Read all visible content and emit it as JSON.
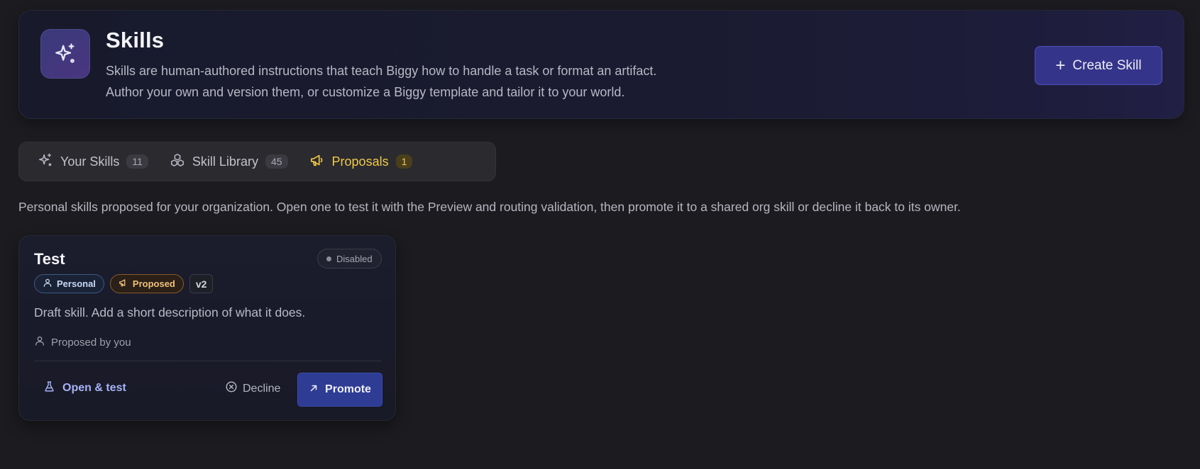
{
  "header": {
    "title": "Skills",
    "description_line1": "Skills are human-authored instructions that teach Biggy how to handle a task or format an artifact.",
    "description_line2": "Author your own and version them, or customize a Biggy template and tailor it to your world.",
    "icon": "sparkles-icon",
    "create_button_label": "Create Skill"
  },
  "tabs": [
    {
      "label": "Your Skills",
      "count": "11",
      "icon": "sparkles-icon",
      "active": false
    },
    {
      "label": "Skill Library",
      "count": "45",
      "icon": "boxes-icon",
      "active": false
    },
    {
      "label": "Proposals",
      "count": "1",
      "icon": "megaphone-icon",
      "active": true
    }
  ],
  "intro": "Personal skills proposed for your organization. Open one to test it with the Preview and routing validation, then promote it to a shared org skill or decline it back to its owner.",
  "card": {
    "title": "Test",
    "status": "Disabled",
    "chips": {
      "personal": "Personal",
      "proposed": "Proposed",
      "version": "v2"
    },
    "description": "Draft skill. Add a short description of what it does.",
    "proposed_by": "Proposed by you",
    "actions": {
      "open": "Open & test",
      "decline": "Decline",
      "promote": "Promote"
    }
  },
  "colors": {
    "accent": "#34358a",
    "active_tab": "#f0c84a",
    "promote": "#2f3c94",
    "link": "#a6b2f4"
  }
}
